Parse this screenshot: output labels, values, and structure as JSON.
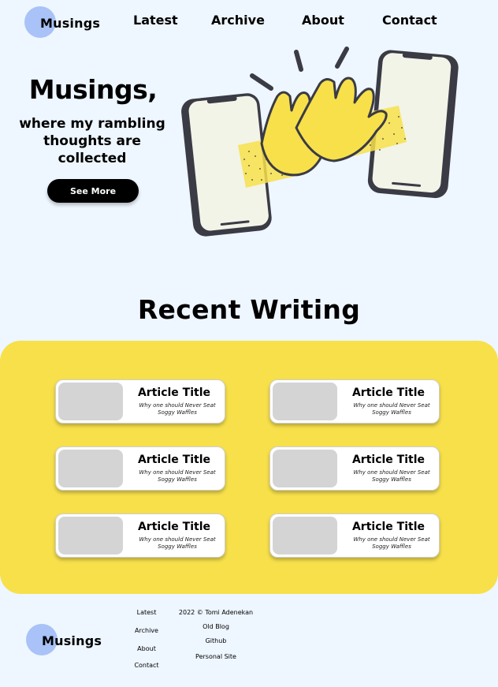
{
  "header": {
    "logo": "Musings",
    "nav": [
      "Latest",
      "Archive",
      "About",
      "Contact"
    ]
  },
  "hero": {
    "title": "Musings,",
    "subtitle": "where my rambling thoughts are collected",
    "cta": "See More"
  },
  "recent": {
    "heading": "Recent Writing",
    "articles": [
      {
        "title": "Article Title",
        "subtitle": "Why one should Never Seat Soggy Waffles"
      },
      {
        "title": "Article Title",
        "subtitle": "Why one should Never Seat Soggy Waffles"
      },
      {
        "title": "Article Title",
        "subtitle": "Why one should Never Seat Soggy Waffles"
      },
      {
        "title": "Article Title",
        "subtitle": "Why one should Never Seat Soggy Waffles"
      },
      {
        "title": "Article Title",
        "subtitle": "Why one should Never Seat Soggy Waffles"
      },
      {
        "title": "Article Title",
        "subtitle": "Why one should Never Seat Soggy Waffles"
      }
    ]
  },
  "footer": {
    "logo": "Musings",
    "nav": [
      "Latest",
      "Archive",
      "About",
      "Contact"
    ],
    "copyright": "2022 © Tomi Adenekan",
    "links": [
      "Old Blog",
      "Github",
      "Personal Site"
    ]
  },
  "colors": {
    "background": "#eef6ff",
    "accent_yellow": "#f7e04a",
    "logo_circle": "#a9c2f7"
  },
  "icons": {
    "hero_illustration": "high-five-phones-illustration"
  }
}
